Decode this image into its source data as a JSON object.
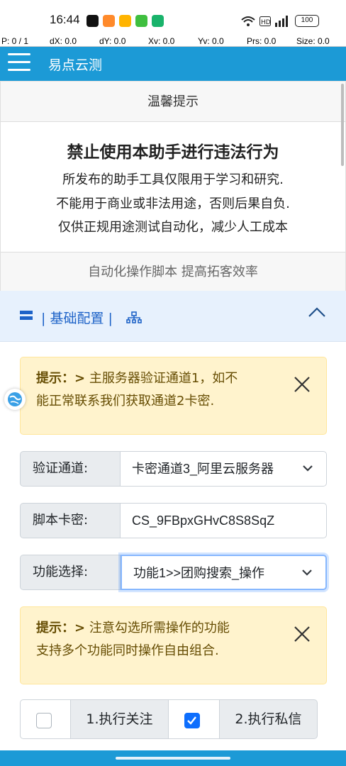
{
  "status_bar": {
    "time": "16:44",
    "battery": "100"
  },
  "pointer_bar": {
    "p": "P: 0 / 1",
    "dx": "dX: 0.0",
    "dy": "dY: 0.0",
    "xv": "Xv: 0.0",
    "yv": "Yv: 0.0",
    "prs": "Prs: 0.0",
    "size": "Size: 0.0"
  },
  "header": {
    "title": "易点云测"
  },
  "notice": {
    "header": "温馨提示",
    "title": "禁止使用本助手进行违法行为",
    "lines": [
      "所发布的助手工具仅限用于学习和研究.",
      "不能用于商业或非法用途，否则后果自负.",
      "仅供正规用途测试自动化，减少人工成本"
    ],
    "footer": "自动化操作脚本 提高拓客效率"
  },
  "accordion": {
    "title": "| 基础配置 |"
  },
  "alert1": {
    "prefix": "提示：",
    "arrow": ">",
    "line1": "主服务器验证通道1，如不",
    "line2": "能正常联系我们获取通道2卡密."
  },
  "form": {
    "channel_label": "验证通道:",
    "channel_value": "卡密通道3_阿里云服务器",
    "key_label": "脚本卡密:",
    "key_value": "CS_9FBpxGHvC8S8SqZ",
    "function_label": "功能选择:",
    "function_value": "功能1>>团购搜索_操作"
  },
  "alert2": {
    "prefix": "提示：",
    "arrow": ">",
    "line1": "注意勾选所需操作的功能",
    "line2": "支持多个功能同时操作自由组合."
  },
  "checks": [
    {
      "label": "1.执行关注",
      "checked": false
    },
    {
      "label": "2.执行私信",
      "checked": true
    }
  ],
  "colors": {
    "primary": "#1c9ad6",
    "accent": "#1e63c8",
    "alert_bg": "#fff3cd",
    "alert_text": "#664d03",
    "checkbox": "#0d6efd"
  },
  "icons": [
    "tiktok-icon",
    "app-orange-icon",
    "app-yellow-icon",
    "wechat-icon",
    "shield-icon",
    "wifi-icon",
    "hd-icon",
    "signal-icon",
    "battery-icon",
    "hamburger-icon",
    "list-icon",
    "sitemap-icon",
    "chevron-up-icon",
    "close-icon",
    "chevron-down-icon",
    "globe-icon",
    "check-icon"
  ]
}
